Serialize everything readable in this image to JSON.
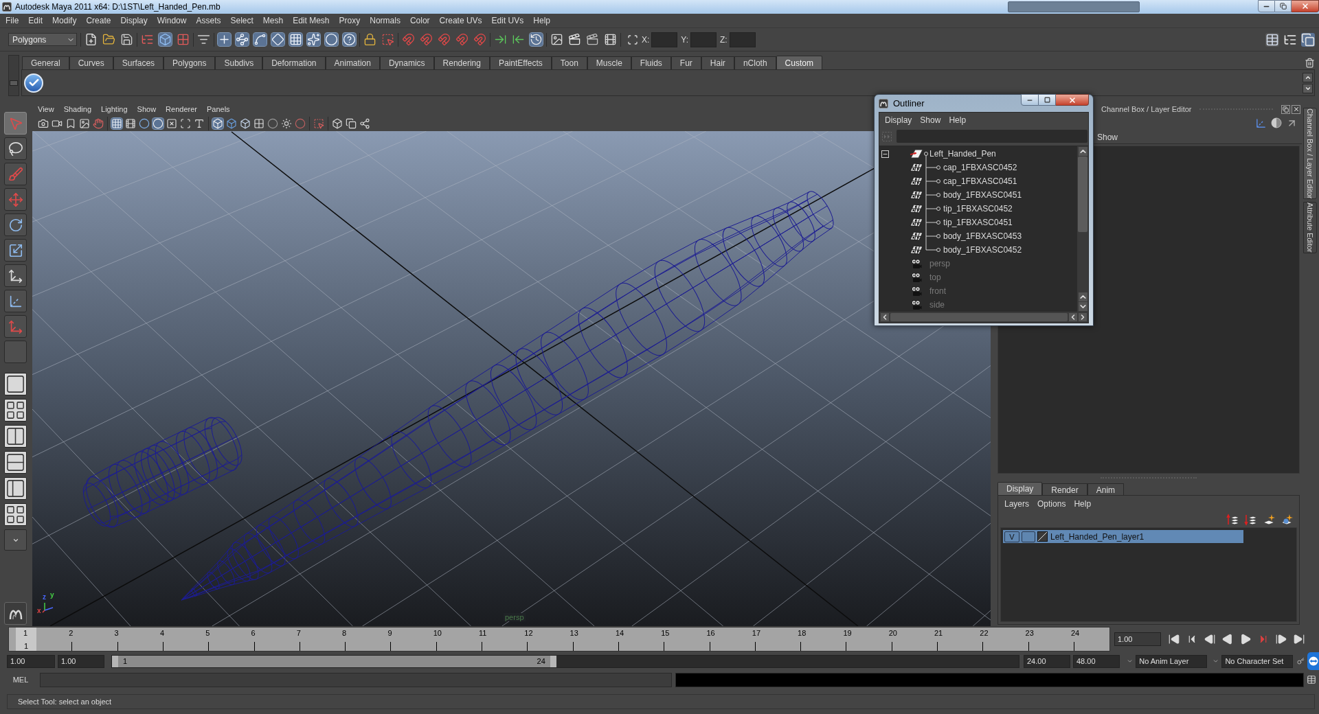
{
  "window": {
    "title": "Autodesk Maya 2011 x64: D:\\1ST\\Left_Handed_Pen.mb"
  },
  "menu_bar": [
    "File",
    "Edit",
    "Modify",
    "Create",
    "Display",
    "Window",
    "Assets",
    "Select",
    "Mesh",
    "Edit Mesh",
    "Proxy",
    "Normals",
    "Color",
    "Create UVs",
    "Edit UVs",
    "Help"
  ],
  "status_line": {
    "menu_set": "Polygons",
    "groups": [
      {
        "items": [
          {
            "kind": "new",
            "on": false
          },
          {
            "kind": "open",
            "on": false
          },
          {
            "kind": "save",
            "on": false
          }
        ]
      },
      {
        "items": [
          {
            "kind": "hierarchy",
            "on": false
          },
          {
            "kind": "object",
            "on": true
          },
          {
            "kind": "component",
            "on": false
          }
        ]
      },
      {
        "items": [
          {
            "kind": "filter",
            "on": false
          }
        ]
      },
      {
        "items": [
          {
            "kind": "handles",
            "on": true
          },
          {
            "kind": "joints",
            "on": true
          },
          {
            "kind": "curves",
            "on": true
          },
          {
            "kind": "surfaces",
            "on": true
          },
          {
            "kind": "deformations",
            "on": true
          },
          {
            "kind": "dynamics",
            "on": true
          },
          {
            "kind": "rendering",
            "on": true
          },
          {
            "kind": "misc",
            "on": true
          }
        ]
      },
      {
        "items": [
          {
            "kind": "lock",
            "on": false
          },
          {
            "kind": "highlight",
            "on": false
          }
        ]
      },
      {
        "items": [
          {
            "kind": "snap",
            "on": false
          },
          {
            "kind": "snap",
            "on": false
          },
          {
            "kind": "snap",
            "on": false
          },
          {
            "kind": "snap",
            "on": false
          },
          {
            "kind": "snap",
            "on": false
          }
        ]
      },
      {
        "items": [
          {
            "kind": "inputs",
            "on": false
          },
          {
            "kind": "outputs",
            "on": false
          },
          {
            "kind": "history",
            "on": true
          }
        ]
      },
      {
        "items": [
          {
            "kind": "render_view",
            "on": false
          },
          {
            "kind": "render",
            "on": false
          },
          {
            "kind": "ipr",
            "on": false
          },
          {
            "kind": "render_settings",
            "on": false
          }
        ]
      }
    ],
    "coordinates": [
      {
        "label": "X:"
      },
      {
        "label": "Y:"
      },
      {
        "label": "Z:"
      }
    ]
  },
  "shelf": {
    "tabs": [
      {
        "label": "General",
        "selected": false
      },
      {
        "label": "Curves",
        "selected": false
      },
      {
        "label": "Surfaces",
        "selected": false
      },
      {
        "label": "Polygons",
        "selected": false
      },
      {
        "label": "Subdivs",
        "selected": false
      },
      {
        "label": "Deformation",
        "selected": false
      },
      {
        "label": "Animation",
        "selected": false
      },
      {
        "label": "Dynamics",
        "selected": false
      },
      {
        "label": "Rendering",
        "selected": false
      },
      {
        "label": "PaintEffects",
        "selected": false
      },
      {
        "label": "Toon",
        "selected": false
      },
      {
        "label": "Muscle",
        "selected": false
      },
      {
        "label": "Fluids",
        "selected": false
      },
      {
        "label": "Fur",
        "selected": false
      },
      {
        "label": "Hair",
        "selected": false
      },
      {
        "label": "nCloth",
        "selected": false
      },
      {
        "label": "Custom",
        "selected": true
      }
    ]
  },
  "toolbox": {
    "tools": [
      {
        "kind": "select",
        "selected": true
      },
      {
        "kind": "lasso",
        "selected": false
      },
      {
        "kind": "paint",
        "selected": false
      },
      {
        "kind": "move",
        "selected": false
      },
      {
        "kind": "rotate",
        "selected": false
      },
      {
        "kind": "scale",
        "selected": false
      },
      {
        "kind": "universal",
        "selected": false
      },
      {
        "kind": "soft_mod",
        "selected": false
      },
      {
        "kind": "show_manip",
        "selected": false
      },
      {
        "kind": "last_tool",
        "selected": false
      }
    ]
  },
  "viewport": {
    "menu": [
      "View",
      "Shading",
      "Lighting",
      "Show",
      "Renderer",
      "Panels"
    ],
    "toolbar_groups": [
      {
        "items": [
          {
            "kind": "camera",
            "on": false
          },
          {
            "kind": "camera_attributes",
            "on": false
          },
          {
            "kind": "bookmark",
            "on": false
          },
          {
            "kind": "image_plane",
            "on": false
          },
          {
            "kind": "pan_zoom",
            "on": false
          }
        ]
      },
      {
        "items": [
          {
            "kind": "grid",
            "on": true
          },
          {
            "kind": "film_gate",
            "on": false
          },
          {
            "kind": "resolution_gate",
            "on": false
          },
          {
            "kind": "gate_mask",
            "on": true
          },
          {
            "kind": "field_chart",
            "on": false
          },
          {
            "kind": "safe_action",
            "on": false
          },
          {
            "kind": "safe_title",
            "on": false
          }
        ]
      },
      {
        "items": [
          {
            "kind": "wireframe",
            "on": true
          },
          {
            "kind": "smooth",
            "on": false
          },
          {
            "kind": "flat",
            "on": false
          },
          {
            "kind": "texture",
            "on": false
          },
          {
            "kind": "lights",
            "on": false
          },
          {
            "kind": "default_light",
            "on": false
          },
          {
            "kind": "shadows",
            "on": false
          }
        ]
      },
      {
        "items": [
          {
            "kind": "isolate",
            "on": false
          }
        ]
      },
      {
        "items": [
          {
            "kind": "xray",
            "on": false
          },
          {
            "kind": "xray_joints",
            "on": false
          },
          {
            "kind": "hud",
            "on": false
          }
        ]
      }
    ],
    "camera": "persp",
    "axes": [
      {
        "label": "z",
        "color": "#4a68ff"
      },
      {
        "label": "y",
        "color": "#46d046"
      },
      {
        "label": "x",
        "color": "#e04444"
      }
    ]
  },
  "outliner": {
    "title": "Outliner",
    "menu": [
      "Display",
      "Show",
      "Help"
    ],
    "items": [
      {
        "name": "Left_Handed_Pen",
        "kind": "group",
        "expanded": true,
        "hidden": false,
        "children": [
          {
            "name": "cap_1FBXASC0452",
            "kind": "mesh",
            "hidden": false
          },
          {
            "name": "cap_1FBXASC0451",
            "kind": "mesh",
            "hidden": false
          },
          {
            "name": "body_1FBXASC0451",
            "kind": "mesh",
            "hidden": false
          },
          {
            "name": "tip_1FBXASC0452",
            "kind": "mesh",
            "hidden": false
          },
          {
            "name": "tip_1FBXASC0451",
            "kind": "mesh",
            "hidden": false
          },
          {
            "name": "body_1FBXASC0453",
            "kind": "mesh",
            "hidden": false
          },
          {
            "name": "body_1FBXASC0452",
            "kind": "mesh",
            "hidden": false
          }
        ]
      },
      {
        "name": "persp",
        "kind": "camera",
        "hidden": true
      },
      {
        "name": "top",
        "kind": "camera",
        "hidden": true
      },
      {
        "name": "front",
        "kind": "camera",
        "hidden": true
      },
      {
        "name": "side",
        "kind": "camera",
        "hidden": true
      }
    ]
  },
  "channel_box": {
    "title": "Channel Box / Layer Editor",
    "menu": [
      "Show"
    ]
  },
  "side_tabs": [
    {
      "label": "Channel Box / Layer Editor",
      "selected": true
    },
    {
      "label": "Attribute Editor",
      "selected": false
    }
  ],
  "layer_editor": {
    "tabs": [
      {
        "label": "Display",
        "selected": true
      },
      {
        "label": "Render",
        "selected": false
      },
      {
        "label": "Anim",
        "selected": false
      }
    ],
    "menu": [
      "Layers",
      "Options",
      "Help"
    ],
    "layers": [
      {
        "name": "Left_Handed_Pen_layer1",
        "visibility": "V",
        "selected": true
      }
    ]
  },
  "time_slider": {
    "ticks": [
      "1",
      "2",
      "3",
      "4",
      "5",
      "6",
      "7",
      "8",
      "9",
      "10",
      "11",
      "12",
      "13",
      "14",
      "15",
      "16",
      "17",
      "18",
      "19",
      "20",
      "21",
      "22",
      "23",
      "24"
    ],
    "level": 0,
    "current_frame": "1",
    "current_time": "1.00"
  },
  "range_slider": {
    "start": "1.00",
    "playback_start": "1.00",
    "level": 0.49,
    "range_start": "1",
    "range_end": "24",
    "playback_end": "24.00",
    "end": "48.00"
  },
  "anim_layer": "No Anim Layer",
  "character_set": "No Character Set",
  "command_line": {
    "language": "MEL"
  },
  "help_line": "Select Tool: select an object"
}
